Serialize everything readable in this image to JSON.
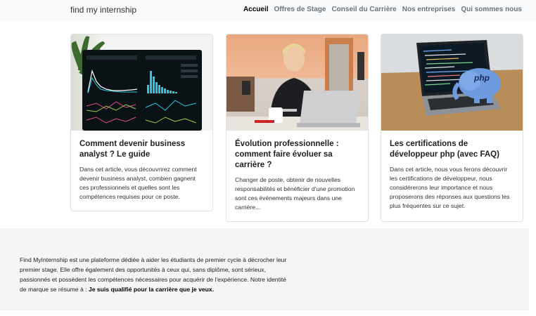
{
  "nav": {
    "brand": "find my internship",
    "links": [
      {
        "label": "Accueil",
        "active": true
      },
      {
        "label": "Offres de Stage",
        "active": false
      },
      {
        "label": "Conseil du Carrière",
        "active": false
      },
      {
        "label": "Nos entreprises",
        "active": false
      },
      {
        "label": "Qui sommes nous",
        "active": false
      }
    ]
  },
  "cards": [
    {
      "title": "Comment devenir business analyst ? Le guide",
      "text": "Dans cet article, vous découvrirez comment devenir business analyst, combien gagnent ces professionnels et quelles sont les compétences requises pour ce poste.",
      "image": "analytics-dashboard-image"
    },
    {
      "title": "Évolution professionnelle : comment faire évoluer sa carrière ?",
      "text": "Changer de poste, obtenir de nouvelles responsabilités et bénéficier d'une promotion sont ces événements majeurs dans une carrière...",
      "image": "woman-laptop-image"
    },
    {
      "title": "Les certifications de développeur php (avec FAQ)",
      "text": "Dans cet article, nous vous ferons découvrir les certifications de développeur, nous considérerons leur importance et nous proposerons des réponses aux questions les plus fréquentes sur ce sujet.",
      "image": "php-elephant-laptop-image"
    }
  ],
  "footer": {
    "text": "Find MyInternship est une plateforme dédiée à aider les étudiants de premier cycle à décrocher leur premier stage. Elle offre également des opportunités à ceux qui, sans diplôme, sont sérieux, passionnés et possèdent les compétences nécessaires pour acquérir de l'expérience. Notre identité de marque se résume à : ",
    "motto": "Je suis qualifié pour la carrière que je veux."
  },
  "colors": {
    "navbar_bg": "#f8f9fa",
    "footer_bg": "#f4f5f7",
    "active_link": "#000000",
    "inactive_link": "#6c757d"
  }
}
